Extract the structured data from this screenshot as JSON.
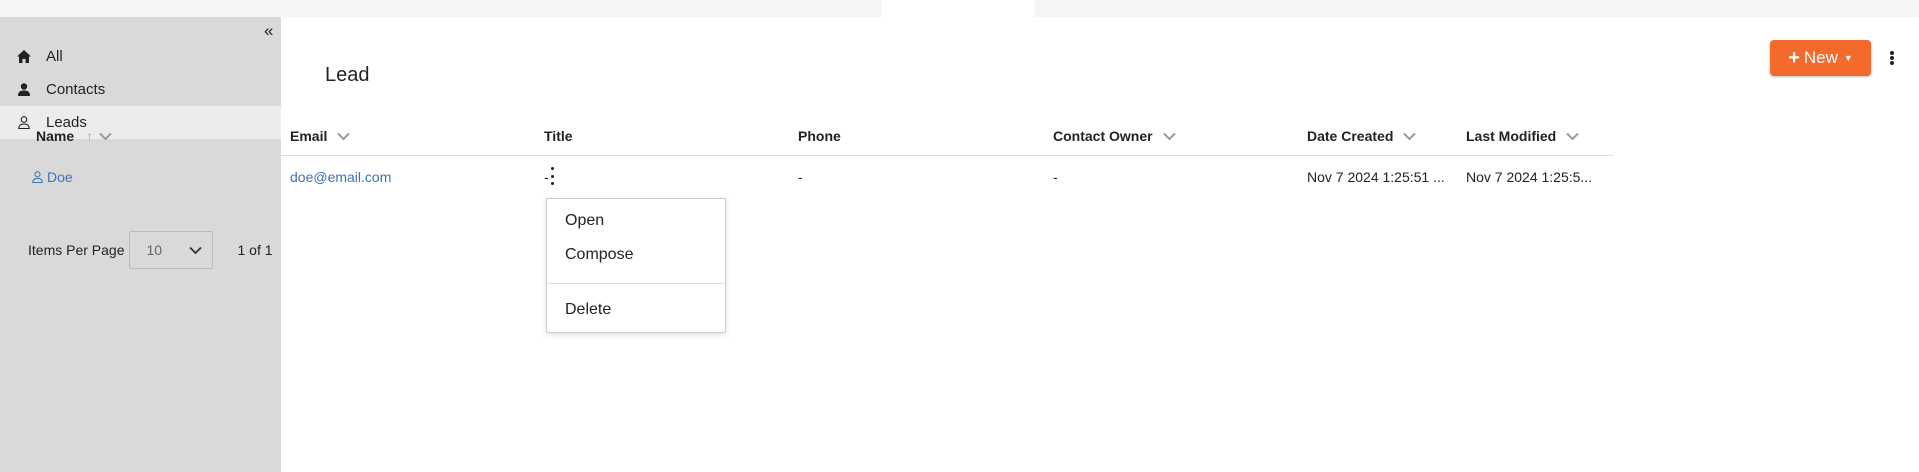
{
  "sidebar": {
    "collapse_glyph": "«",
    "items": [
      {
        "label": "All",
        "icon": "home-icon"
      },
      {
        "label": "Contacts",
        "icon": "person-filled-icon"
      },
      {
        "label": "Leads",
        "icon": "person-outline-icon",
        "active": true
      }
    ]
  },
  "main": {
    "title": "Lead",
    "new_button": {
      "label": "New",
      "color": "#f36a2b"
    }
  },
  "table": {
    "columns": [
      "Name",
      "Email",
      "Title",
      "Phone",
      "Contact Owner",
      "Date Created",
      "Last Modified"
    ],
    "rows": [
      {
        "name": "Doe",
        "email": "doe@email.com",
        "title": "-",
        "phone": "-",
        "owner": "-",
        "created": "Nov 7 2024 1:25:51 ...",
        "modified": "Nov 7 2024 1:25:5..."
      }
    ]
  },
  "pager": {
    "label": "Items Per Page",
    "per_page": "10",
    "count": "1 of 1"
  },
  "context_menu": {
    "items": [
      "Open",
      "Compose",
      "Delete"
    ]
  },
  "colors": {
    "accent": "#f36a2b",
    "link": "#3d72b4",
    "sidebar_bg": "#d9d9d9"
  }
}
